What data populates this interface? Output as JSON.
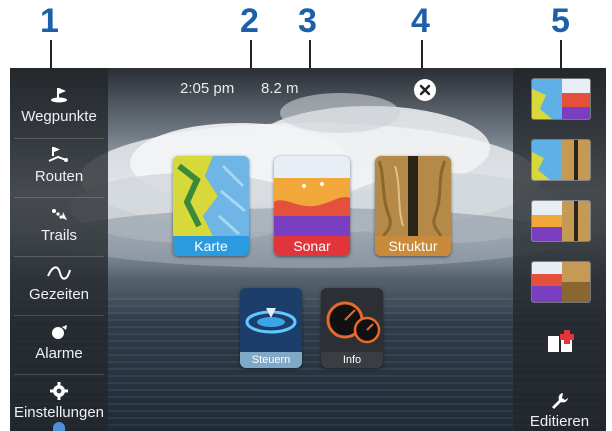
{
  "callouts": [
    "1",
    "2",
    "3",
    "4",
    "5"
  ],
  "status": {
    "time": "2:05 pm",
    "depth": "8.2 m"
  },
  "sidebar": {
    "items": [
      {
        "label": "Wegpunkte",
        "icon": "waypoint-icon"
      },
      {
        "label": "Routen",
        "icon": "route-icon"
      },
      {
        "label": "Trails",
        "icon": "trail-icon"
      },
      {
        "label": "Gezeiten",
        "icon": "tide-icon"
      },
      {
        "label": "Alarme",
        "icon": "alarm-icon"
      },
      {
        "label": "Einstellungen",
        "icon": "gear-icon"
      }
    ]
  },
  "apps": {
    "large": [
      {
        "label": "Karte",
        "caption_color": "#2b9be0"
      },
      {
        "label": "Sonar",
        "caption_color": "#e0353b"
      },
      {
        "label": "Struktur",
        "caption_color": "#c98a3a"
      }
    ],
    "small": [
      {
        "label": "Steuern",
        "caption_color": "#7fa9c6"
      },
      {
        "label": "Info",
        "caption_color": "#3a3d42"
      }
    ]
  },
  "rightbar": {
    "favorites": [
      "chart-sonar-favorite",
      "chart-structure-favorite",
      "sonar-structure-favorite",
      "sonar-structure-split-favorite"
    ],
    "add_icon": "add-page-icon",
    "edit_label": "Editieren"
  }
}
